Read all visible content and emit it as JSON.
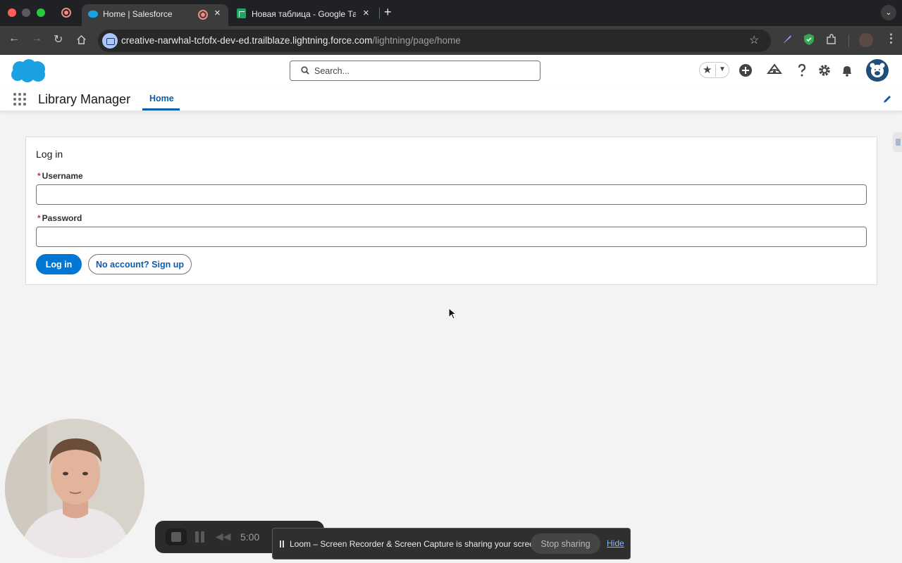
{
  "browser": {
    "tabs": [
      {
        "title": "Home | Salesforce",
        "active": true
      },
      {
        "title": "Новая таблица - Google Таблицы",
        "active": false
      }
    ],
    "new_tab_symbol": "+",
    "url_host": "creative-narwhal-tcfofx-dev-ed.trailblaze.lightning.force.com",
    "url_path": "/lightning/page/home"
  },
  "header": {
    "search_placeholder": "Search..."
  },
  "app": {
    "name": "Library Manager",
    "tabs": [
      {
        "label": "Home",
        "active": true
      }
    ]
  },
  "login": {
    "title": "Log in",
    "username_label": "Username",
    "password_label": "Password",
    "required_mark": "*",
    "username_value": "",
    "password_value": "",
    "login_button": "Log in",
    "signup_button": "No account? Sign up"
  },
  "loom": {
    "timer": "5:00",
    "share_message": "Loom – Screen Recorder & Screen Capture is sharing your screen.",
    "stop_sharing": "Stop sharing",
    "hide": "Hide"
  },
  "colors": {
    "brand": "#0176d3",
    "active_tab": "#0b5cab",
    "required": "#c23934",
    "salesforce_cloud": "#1ba1e2"
  }
}
